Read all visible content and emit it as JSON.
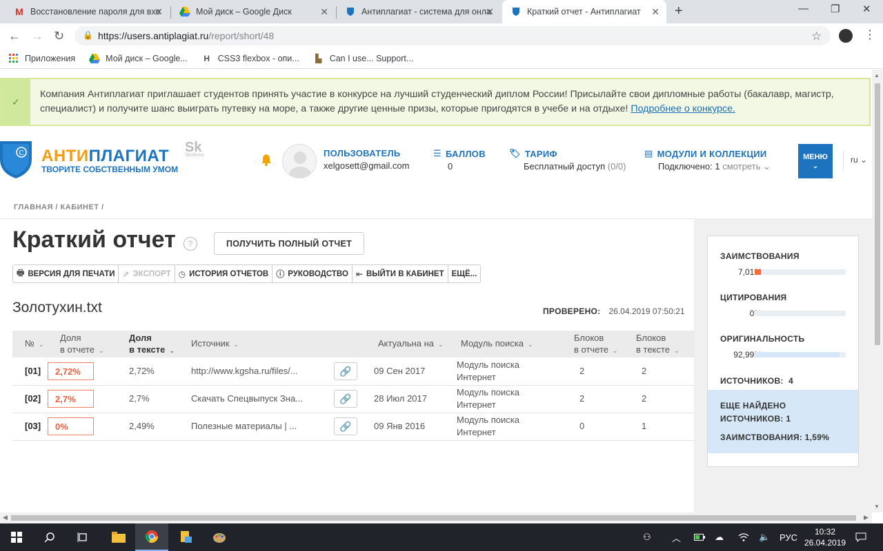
{
  "browser": {
    "tabs": [
      {
        "title": "Восстановление пароля для вхо",
        "icon": "gmail-icon"
      },
      {
        "title": "Мой диск – Google Диск",
        "icon": "google-drive-icon"
      },
      {
        "title": "Антиплагиат - система для онла",
        "icon": "shield-icon"
      },
      {
        "title": "Краткий отчет - Антиплагиат",
        "icon": "shield-icon"
      }
    ],
    "url_host": "https://users.antiplagiat.ru",
    "url_path": "/report/short/48",
    "bookmarks": [
      {
        "label": "Приложения"
      },
      {
        "label": "Мой диск – Google..."
      },
      {
        "label": "CSS3 flexbox - опи..."
      },
      {
        "label": "Can I use... Support..."
      }
    ]
  },
  "notice": {
    "text": "Компания Антиплагиат приглашает студентов принять участие в конкурсе на лучший студенческий диплом России! Присылайте свои дипломные работы (бакалавр, магистр, специалист) и получите шанс выиграть путевку на море, а также другие ценные призы, которые пригодятся в учебе и на отдыхе! ",
    "link": "Подробнее о конкурсе."
  },
  "header": {
    "logo_part1": "АНТИ",
    "logo_part2": "ПЛАГИАТ",
    "logo_sub": "ТВОРИТЕ СОБСТВЕННЫМ УМОМ",
    "skolkovo": "Sk",
    "skolkovo_sub": "Skolkovo",
    "user_title": "ПОЛЬЗОВАТЕЛЬ",
    "user_email": "xelgosett@gmail.com",
    "points_title": "БАЛЛОВ",
    "points_value": "0",
    "tariff_title": "ТАРИФ",
    "tariff_value": "Бесплатный доступ",
    "tariff_count": "(0/0)",
    "modules_title": "МОДУЛИ И КОЛЛЕКЦИИ",
    "modules_connected": "Подключено: 1",
    "modules_see": "смотреть",
    "menu_label": "МЕНЮ",
    "lang": "ru"
  },
  "breadcrumb": "ГЛАВНАЯ / КАБИНЕТ /",
  "report": {
    "title": "Краткий отчет",
    "full_report_button": "ПОЛУЧИТЬ ПОЛНЫЙ ОТЧЕТ",
    "toolbar": {
      "print": "ВЕРСИЯ ДЛЯ ПЕЧАТИ",
      "export": "ЭКСПОРТ",
      "history": "ИСТОРИЯ ОТЧЕТОВ",
      "guide": "РУКОВОДСТВО",
      "exit": "ВЫЙТИ В КАБИНЕТ",
      "more": "ЕЩЁ..."
    },
    "filename": "Золотухин.txt",
    "checked_label": "ПРОВЕРЕНО:",
    "checked_date": "26.04.2019 07:50:21"
  },
  "table": {
    "headers": {
      "num": "№",
      "share_report_1": "Доля",
      "share_report_2": "в отчете",
      "share_text_1": "Доля",
      "share_text_2": "в тексте",
      "source": "Источник",
      "actual": "Актуальна на",
      "module": "Модуль поиска",
      "blocks_report_1": "Блоков",
      "blocks_report_2": "в отчете",
      "blocks_text_1": "Блоков",
      "blocks_text_2": "в тексте"
    },
    "rows": [
      {
        "num": "[01]",
        "share_report": "2,72%",
        "share_text": "2,72%",
        "source": "http://www.kgsha.ru/files/...",
        "actual": "09 Сен 2017",
        "module_1": "Модуль поиска",
        "module_2": "Интернет",
        "blocks_report": "2",
        "blocks_text": "2"
      },
      {
        "num": "[02]",
        "share_report": "2,7%",
        "share_text": "2,7%",
        "source": "Скачать Спецвыпуск Зна...",
        "actual": "28 Июл 2017",
        "module_1": "Модуль поиска",
        "module_2": "Интернет",
        "blocks_report": "2",
        "blocks_text": "2"
      },
      {
        "num": "[03]",
        "share_report": "0%",
        "share_text": "2,49%",
        "source": "Полезные материалы | ...",
        "actual": "09 Янв 2016",
        "module_1": "Модуль поиска",
        "module_2": "Интернет",
        "blocks_report": "0",
        "blocks_text": "1"
      }
    ]
  },
  "stats": {
    "borrow_label": "ЗАИМСТВОВАНИЯ",
    "borrow_value": "7,01%",
    "borrow_fraction": 0.0701,
    "cite_label": "ЦИТИРОВАНИЯ",
    "cite_value": "0%",
    "cite_fraction": 0,
    "orig_label": "ОРИГИНАЛЬНОСТЬ",
    "orig_value": "92,99%",
    "orig_fraction": 0.9299,
    "sources_label": "ИСТОЧНИКОВ:",
    "sources_value": "4",
    "more_line1": "ЕЩЕ НАЙДЕНО",
    "more_line2": "ИСТОЧНИКОВ: 1",
    "more_line3": "ЗАИМСТВОВАНИЯ: 1,59%",
    "colors": {
      "borrow": "#f26b3a",
      "orig": "#d6e8f7",
      "track": "#e8eef3"
    }
  },
  "taskbar": {
    "lang": "РУС",
    "time": "10:32",
    "date": "26.04.2019"
  }
}
